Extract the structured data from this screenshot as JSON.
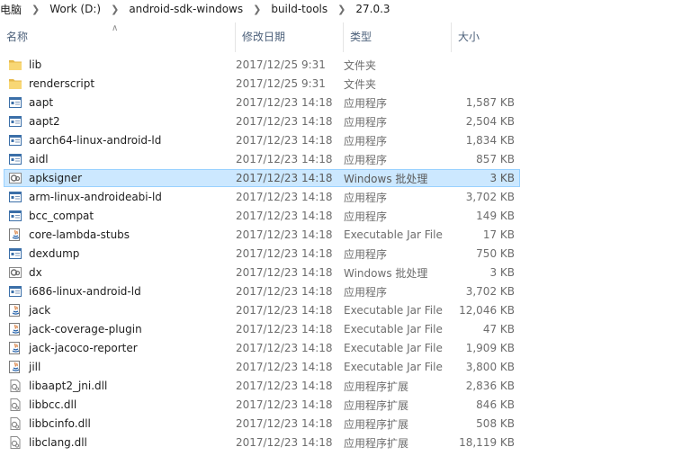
{
  "breadcrumb": [
    "电脑",
    "Work (D:)",
    "android-sdk-windows",
    "build-tools",
    "27.0.3"
  ],
  "columns": {
    "name": "名称",
    "date": "修改日期",
    "type": "类型",
    "size": "大小"
  },
  "files": [
    {
      "name": "lib",
      "date": "2017/12/25 9:31",
      "type": "文件夹",
      "size": "",
      "icon": "folder-icon"
    },
    {
      "name": "renderscript",
      "date": "2017/12/25 9:31",
      "type": "文件夹",
      "size": "",
      "icon": "folder-icon"
    },
    {
      "name": "aapt",
      "date": "2017/12/23 14:18",
      "type": "应用程序",
      "size": "1,587 KB",
      "icon": "exe-icon"
    },
    {
      "name": "aapt2",
      "date": "2017/12/23 14:18",
      "type": "应用程序",
      "size": "2,504 KB",
      "icon": "exe-icon"
    },
    {
      "name": "aarch64-linux-android-ld",
      "date": "2017/12/23 14:18",
      "type": "应用程序",
      "size": "1,834 KB",
      "icon": "exe-icon"
    },
    {
      "name": "aidl",
      "date": "2017/12/23 14:18",
      "type": "应用程序",
      "size": "857 KB",
      "icon": "exe-icon"
    },
    {
      "name": "apksigner",
      "date": "2017/12/23 14:18",
      "type": "Windows 批处理",
      "size": "3 KB",
      "icon": "batch-icon",
      "selected": true
    },
    {
      "name": "arm-linux-androideabi-ld",
      "date": "2017/12/23 14:18",
      "type": "应用程序",
      "size": "3,702 KB",
      "icon": "exe-icon"
    },
    {
      "name": "bcc_compat",
      "date": "2017/12/23 14:18",
      "type": "应用程序",
      "size": "149 KB",
      "icon": "exe-icon"
    },
    {
      "name": "core-lambda-stubs",
      "date": "2017/12/23 14:18",
      "type": "Executable Jar File",
      "size": "17 KB",
      "icon": "jar-icon"
    },
    {
      "name": "dexdump",
      "date": "2017/12/23 14:18",
      "type": "应用程序",
      "size": "750 KB",
      "icon": "exe-icon"
    },
    {
      "name": "dx",
      "date": "2017/12/23 14:18",
      "type": "Windows 批处理",
      "size": "3 KB",
      "icon": "batch-icon"
    },
    {
      "name": "i686-linux-android-ld",
      "date": "2017/12/23 14:18",
      "type": "应用程序",
      "size": "3,702 KB",
      "icon": "exe-icon"
    },
    {
      "name": "jack",
      "date": "2017/12/23 14:18",
      "type": "Executable Jar File",
      "size": "12,046 KB",
      "icon": "jar-icon"
    },
    {
      "name": "jack-coverage-plugin",
      "date": "2017/12/23 14:18",
      "type": "Executable Jar File",
      "size": "47 KB",
      "icon": "jar-icon"
    },
    {
      "name": "jack-jacoco-reporter",
      "date": "2017/12/23 14:18",
      "type": "Executable Jar File",
      "size": "1,909 KB",
      "icon": "jar-icon"
    },
    {
      "name": "jill",
      "date": "2017/12/23 14:18",
      "type": "Executable Jar File",
      "size": "3,800 KB",
      "icon": "jar-icon"
    },
    {
      "name": "libaapt2_jni.dll",
      "date": "2017/12/23 14:18",
      "type": "应用程序扩展",
      "size": "2,836 KB",
      "icon": "dll-icon"
    },
    {
      "name": "libbcc.dll",
      "date": "2017/12/23 14:18",
      "type": "应用程序扩展",
      "size": "846 KB",
      "icon": "dll-icon"
    },
    {
      "name": "libbcinfo.dll",
      "date": "2017/12/23 14:18",
      "type": "应用程序扩展",
      "size": "508 KB",
      "icon": "dll-icon"
    },
    {
      "name": "libclang.dll",
      "date": "2017/12/23 14:18",
      "type": "应用程序扩展",
      "size": "18,119 KB",
      "icon": "dll-icon"
    }
  ],
  "colors": {
    "selection_bg": "#cce8ff",
    "selection_border": "#99d1ff",
    "folder": "#f8d775",
    "header_text": "#4c607a"
  }
}
